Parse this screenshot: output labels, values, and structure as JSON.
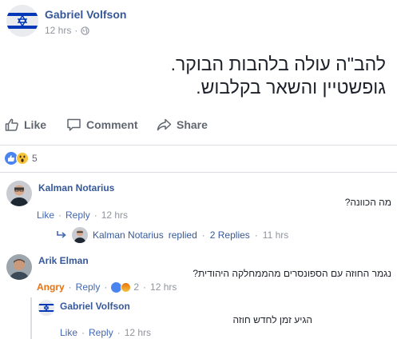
{
  "post": {
    "author": "Gabriel Volfson",
    "time": "12 hrs",
    "separator": "·",
    "privacy_icon": "globe-icon",
    "body_lines": [
      "להב\"ה עולה בלהבות הבוקר.",
      "גופשטיין והשאר בקלבוש."
    ]
  },
  "actions": {
    "like": "Like",
    "comment": "Comment",
    "share": "Share"
  },
  "reactions": {
    "icons": [
      "like-reaction-icon",
      "wow-reaction-icon"
    ],
    "count": "5"
  },
  "comments": [
    {
      "author": "Kalman Notarius",
      "text": "מה הכוונה?",
      "like": "Like",
      "reply": "Reply",
      "time": "12 hrs",
      "replies_summary": {
        "author": "Kalman Notarius",
        "action": "replied",
        "count_label": "2 Replies",
        "time": "11 hrs"
      }
    },
    {
      "author": "Arik Elman",
      "text": "נגמר החוזה עם הספונסרים מהממחלקה היהודית?",
      "reaction_label": "Angry",
      "reply": "Reply",
      "reaction_count": "2",
      "time": "12 hrs"
    },
    {
      "author": "Gabriel Volfson",
      "text": "הגיע זמן לחדש חוזה",
      "like": "Like",
      "reply": "Reply",
      "time": "12 hrs"
    }
  ],
  "colors": {
    "link_blue": "#365899",
    "action_blue": "#4267b2",
    "meta_gray": "#90949c",
    "angry_orange": "#e9710f",
    "israel_blue": "#0038b8"
  }
}
